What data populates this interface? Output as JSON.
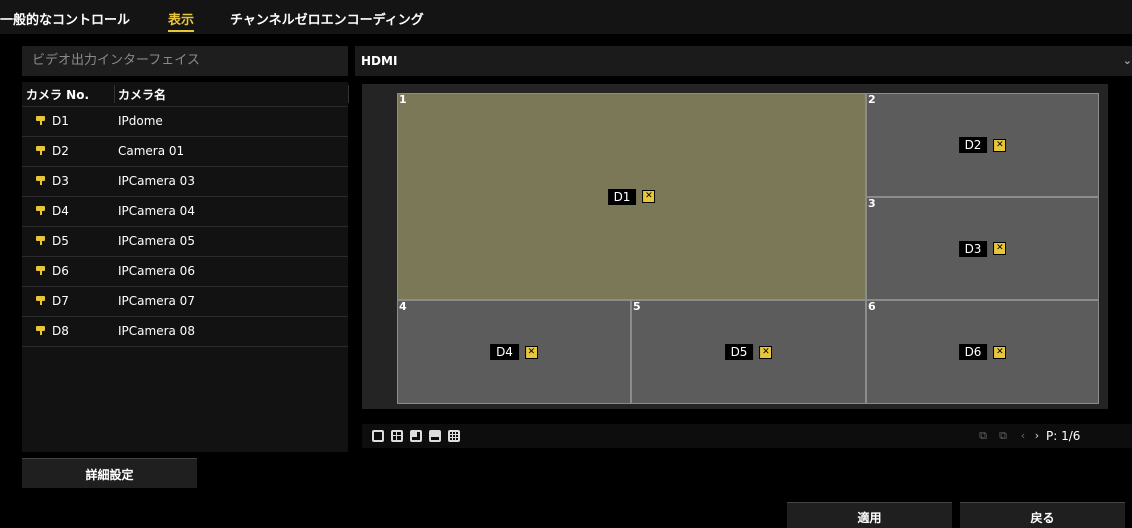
{
  "tabs": [
    "一般的なコントロール",
    "表示",
    "チャンネルゼロエンコーディング"
  ],
  "video_output": {
    "label": "ビデオ出力インターフェイス",
    "value": "HDMI"
  },
  "camera_list": {
    "col_no": "カメラ No.",
    "col_name": "カメラ名",
    "rows": [
      {
        "no": "D1",
        "name": "IPdome"
      },
      {
        "no": "D2",
        "name": "Camera 01"
      },
      {
        "no": "D3",
        "name": "IPCamera 03"
      },
      {
        "no": "D4",
        "name": "IPCamera 04"
      },
      {
        "no": "D5",
        "name": "IPCamera 05"
      },
      {
        "no": "D6",
        "name": "IPCamera 06"
      },
      {
        "no": "D7",
        "name": "IPCamera 07"
      },
      {
        "no": "D8",
        "name": "IPCamera 08"
      }
    ]
  },
  "preview": {
    "tiles": [
      {
        "num": "1",
        "cam": "D1"
      },
      {
        "num": "2",
        "cam": "D2"
      },
      {
        "num": "3",
        "cam": "D3"
      },
      {
        "num": "4",
        "cam": "D4"
      },
      {
        "num": "5",
        "cam": "D5"
      },
      {
        "num": "6",
        "cam": "D6"
      }
    ],
    "close_glyph": "✕",
    "page": "P: 1/6"
  },
  "icons": [
    "camera-icon",
    "close-icon",
    "layout-1-icon",
    "layout-4-icon",
    "layout-6-icon",
    "layout-8-icon",
    "layout-9-icon",
    "prev-page-icon",
    "next-page-icon"
  ],
  "buttons": {
    "advanced": "詳細設定",
    "apply": "適用",
    "back": "戻る"
  },
  "colors": {
    "accent": "#e8c63a",
    "selected_tile": "#7b7858",
    "tile": "#5c5c5c"
  }
}
